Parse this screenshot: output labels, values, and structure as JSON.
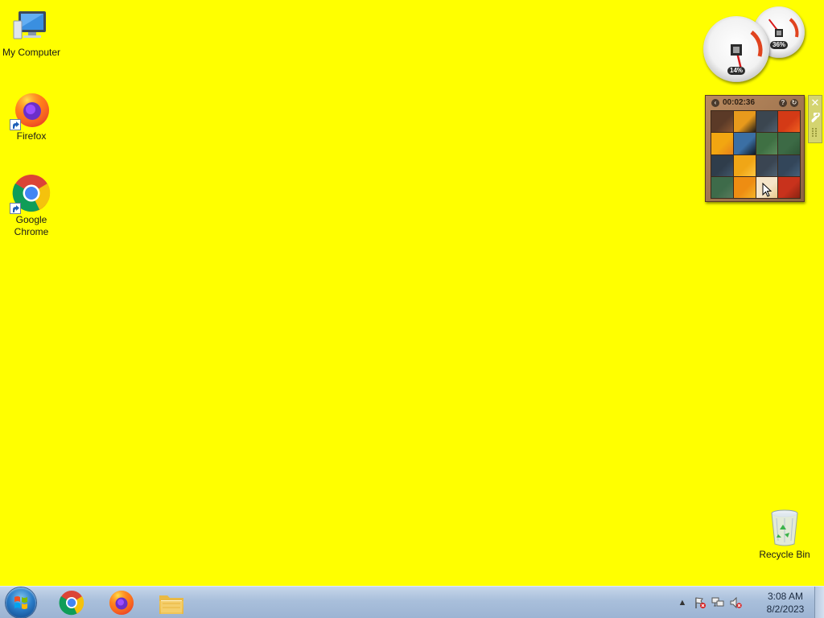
{
  "desktop": {
    "background": "#ffff00",
    "icons": [
      {
        "label": "My Computer",
        "icon": "computer-icon",
        "shortcut": false
      },
      {
        "label": "Firefox",
        "icon": "firefox-icon",
        "shortcut": true
      },
      {
        "label": "Google Chrome",
        "icon": "chrome-icon",
        "shortcut": true
      },
      {
        "label": "Recycle Bin",
        "icon": "recycle-bin-icon",
        "shortcut": false
      }
    ]
  },
  "gadgets": {
    "cpu_meter": {
      "cpu_readout": "14%",
      "memory_readout": "36%",
      "cpu_level": 0.14,
      "memory_level": 0.36,
      "cpu_icon": "cpu-chip-icon",
      "memory_icon": "memory-chip-icon"
    },
    "slide_puzzle": {
      "timer": "00:02:36",
      "back_icon": "back-arrow-icon",
      "help_icon": "help-icon",
      "scramble_icon": "scramble-icon",
      "tiles": [
        {
          "color": "#5b3a27",
          "accent": "#8a5632"
        },
        {
          "color": "#e89a1c",
          "accent": "#1d1a18"
        },
        {
          "color": "#3b4650",
          "accent": "#506070"
        },
        {
          "color": "#d43a16",
          "accent": "#f06020"
        },
        {
          "color": "#f2a611",
          "accent": "#e5801a"
        },
        {
          "color": "#3b6fa4",
          "accent": "#101820"
        },
        {
          "color": "#3f7043",
          "accent": "#5a8a5a"
        },
        {
          "color": "#3c6a45",
          "accent": "#2f5736"
        },
        {
          "color": "#2f3d4b",
          "accent": "#41566a"
        },
        {
          "color": "#f0a616",
          "accent": "#ffc640"
        },
        {
          "color": "#3a4552",
          "accent": "#4f6272"
        },
        {
          "color": "#33465a",
          "accent": "#46607a"
        },
        {
          "color": "#3e6b4a",
          "accent": "#577b5c"
        },
        {
          "color": "#ee8d12",
          "accent": "#f5b52a"
        },
        {
          "color": "#f6e5c8",
          "accent": "#e8c98c"
        },
        {
          "color": "#c8321c",
          "accent": "#8a2312"
        }
      ]
    },
    "toolbar": {
      "close_icon": "close-icon",
      "options_icon": "wrench-icon",
      "drag_icon": "drag-handle-icon"
    }
  },
  "taskbar": {
    "start_icon": "windows-start-icon",
    "pinned": [
      {
        "name": "Google Chrome",
        "icon": "chrome-icon"
      },
      {
        "name": "Firefox",
        "icon": "firefox-icon"
      },
      {
        "name": "Windows Explorer",
        "icon": "folder-icon"
      }
    ],
    "tray": {
      "show_hidden_icon": "chevron-up-icon",
      "action_center_icon": "flag-alert-icon",
      "network_icon": "network-icon",
      "volume_icon": "volume-muted-icon"
    },
    "clock": {
      "time": "3:08 AM",
      "date": "8/2/2023"
    }
  }
}
